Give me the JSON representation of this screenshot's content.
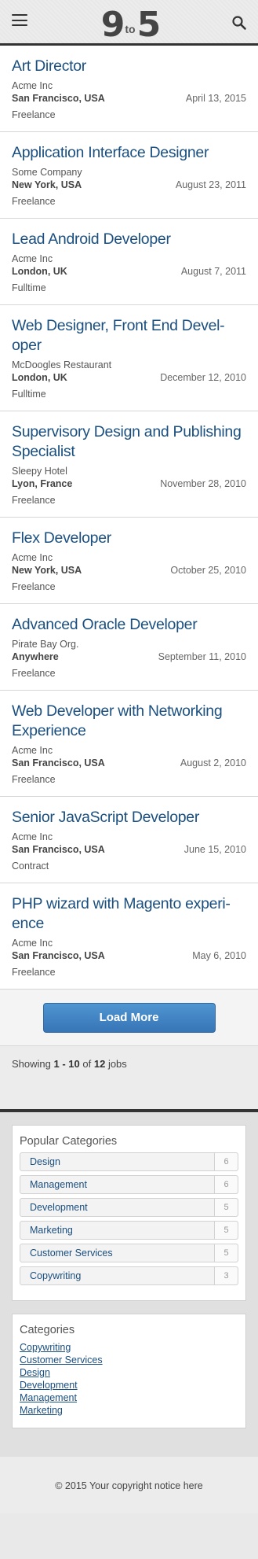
{
  "header": {
    "logo_nine": "9",
    "logo_to": "to",
    "logo_five": "5"
  },
  "jobs": [
    {
      "title": "Art Director",
      "company": "Acme Inc",
      "location": "San Francisco, USA",
      "date": "April 13, 2015",
      "type": "Freelance"
    },
    {
      "title": "Application Interface Designer",
      "company": "Some Company",
      "location": "New York, USA",
      "date": "August 23, 2011",
      "type": "Freelance"
    },
    {
      "title": "Lead Android Developer",
      "company": "Acme Inc",
      "location": "London, UK",
      "date": "August 7, 2011",
      "type": "Fulltime"
    },
    {
      "title": "Web Designer, Front End Devel-oper",
      "company": "McDoogles Restaurant",
      "location": "London, UK",
      "date": "December 12, 2010",
      "type": "Fulltime"
    },
    {
      "title": "Supervisory Design and Publishing Specialist",
      "company": "Sleepy Hotel",
      "location": "Lyon, France",
      "date": "November 28, 2010",
      "type": "Freelance"
    },
    {
      "title": "Flex Developer",
      "company": "Acme Inc",
      "location": "New York, USA",
      "date": "October 25, 2010",
      "type": "Freelance"
    },
    {
      "title": "Advanced Oracle Developer",
      "company": "Pirate Bay Org.",
      "location": "Anywhere",
      "date": "September 11, 2010",
      "type": "Freelance"
    },
    {
      "title": "Web Developer with Networking Experience",
      "company": "Acme Inc",
      "location": "San Francisco, USA",
      "date": "August 2, 2010",
      "type": "Freelance"
    },
    {
      "title": "Senior JavaScript Developer",
      "company": "Acme Inc",
      "location": "San Francisco, USA",
      "date": "June 15, 2010",
      "type": "Contract"
    },
    {
      "title": "PHP wizard with Magento experi-ence",
      "company": "Acme Inc",
      "location": "San Francisco, USA",
      "date": "May 6, 2010",
      "type": "Freelance"
    }
  ],
  "load_more_label": "Load More",
  "showing": {
    "prefix": "Showing",
    "range": "1 - 10",
    "of": "of",
    "total": "12",
    "suffix": "jobs"
  },
  "popular_categories": {
    "title": "Popular Categories",
    "items": [
      {
        "label": "Design",
        "count": "6"
      },
      {
        "label": "Management",
        "count": "6"
      },
      {
        "label": "Development",
        "count": "5"
      },
      {
        "label": "Marketing",
        "count": "5"
      },
      {
        "label": "Customer Services",
        "count": "5"
      },
      {
        "label": "Copywriting",
        "count": "3"
      }
    ]
  },
  "categories": {
    "title": "Categories",
    "items": [
      "Copywriting",
      "Customer Services",
      "Design",
      "Development",
      "Management",
      "Marketing"
    ]
  },
  "footer": {
    "copyright": "© 2015 Your copyright notice here"
  },
  "icons": {
    "menu": "hamburger-icon",
    "search": "search-icon"
  }
}
